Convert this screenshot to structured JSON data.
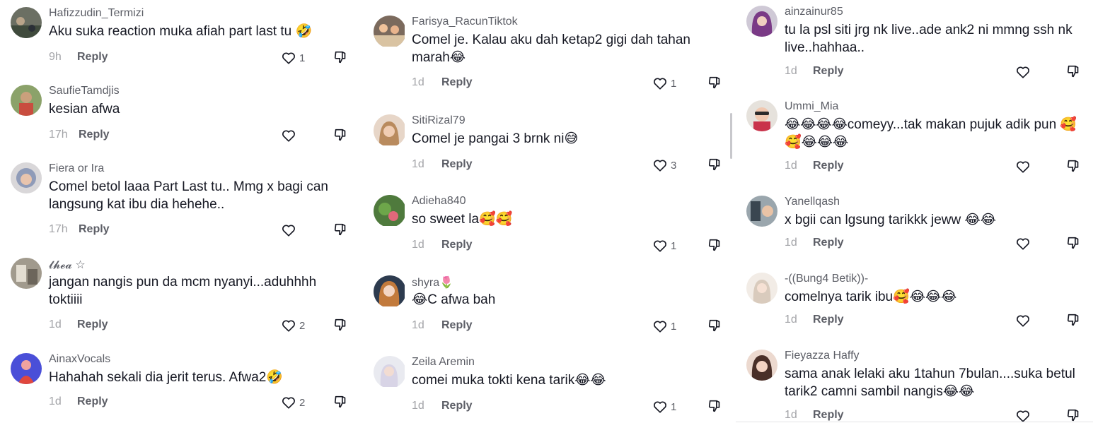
{
  "columns": [
    {
      "comments": [
        {
          "username": "Hafizzudin_Termizi",
          "text": "Aku suka reaction muka afiah part last tu 🤣",
          "time": "9h",
          "reply": "Reply",
          "likes": "1",
          "avatar": "avatar-1"
        },
        {
          "username": "SaufieTamdjis",
          "text": "kesian afwa",
          "time": "17h",
          "reply": "Reply",
          "likes": "",
          "avatar": "avatar-2"
        },
        {
          "username": "Fiera or Ira",
          "text": "Comel betol laaa Part Last tu.. Mmg x bagi can langsung kat ibu dia hehehe..",
          "time": "17h",
          "reply": "Reply",
          "likes": "",
          "avatar": "avatar-3"
        },
        {
          "username": "𝓽𝓱𝓮𝓪 ☆",
          "text": "jangan nangis pun da mcm nyanyi...aduhhhh toktiiii",
          "time": "1d",
          "reply": "Reply",
          "likes": "2",
          "avatar": "avatar-4"
        },
        {
          "username": "AinaxVocals",
          "text": "Hahahah sekali dia jerit terus. Afwa2🤣",
          "time": "1d",
          "reply": "Reply",
          "likes": "2",
          "avatar": "avatar-5"
        }
      ]
    },
    {
      "comments": [
        {
          "username": "Farisya_RacunTiktok",
          "text": "Comel je. Kalau aku dah ketap2 gigi dah tahan marah😂",
          "time": "1d",
          "reply": "Reply",
          "likes": "1",
          "avatar": "avatar-6"
        },
        {
          "username": "SitiRizal79",
          "text": "Comel je pangai 3 brnk ni😅",
          "time": "1d",
          "reply": "Reply",
          "likes": "3",
          "avatar": "avatar-7"
        },
        {
          "username": "Adieha840",
          "text": "so sweet la🥰🥰",
          "time": "1d",
          "reply": "Reply",
          "likes": "1",
          "avatar": "avatar-8"
        },
        {
          "username": "shyra🌷",
          "text": "😂C afwa bah",
          "time": "1d",
          "reply": "Reply",
          "likes": "1",
          "avatar": "avatar-9"
        },
        {
          "username": "Zeila Aremin",
          "text": "comei muka tokti kena tarik😂😂",
          "time": "1d",
          "reply": "Reply",
          "likes": "1",
          "avatar": "avatar-10"
        }
      ]
    },
    {
      "comments": [
        {
          "username": "ainzainur85",
          "text": "tu la psl siti jrg nk live..ade ank2 ni mmng ssh nk live..hahhaa..",
          "time": "1d",
          "reply": "Reply",
          "likes": "",
          "avatar": "avatar-11"
        },
        {
          "username": "Ummi_Mia",
          "text": "😂😂😂😂comeyy...tak makan pujuk adik pun 🥰🥰😂😂😂",
          "time": "1d",
          "reply": "Reply",
          "likes": "",
          "avatar": "avatar-12"
        },
        {
          "username": "Yanellqash",
          "text": "x bgii can lgsung tarikkk jeww 😂😂",
          "time": "1d",
          "reply": "Reply",
          "likes": "",
          "avatar": "avatar-13"
        },
        {
          "username": "-((Bung4 Betik))-",
          "text": "comelnya tarik ibu🥰😂😂😂",
          "time": "1d",
          "reply": "Reply",
          "likes": "",
          "avatar": "avatar-14"
        },
        {
          "username": "Fieyazza Haffy",
          "text": "sama anak lelaki aku 1tahun 7bulan....suka betul tarik2 camni sambil nangis😂😂",
          "time": "1d",
          "reply": "Reply",
          "likes": "",
          "avatar": "avatar-15"
        }
      ]
    }
  ],
  "colors": {
    "text": "#161823",
    "username": "#5c5e66",
    "time": "#a3a4a8",
    "icon": "#161823"
  },
  "icons": {
    "like": "heart-outline-icon",
    "dislike": "thumbs-down-icon"
  }
}
